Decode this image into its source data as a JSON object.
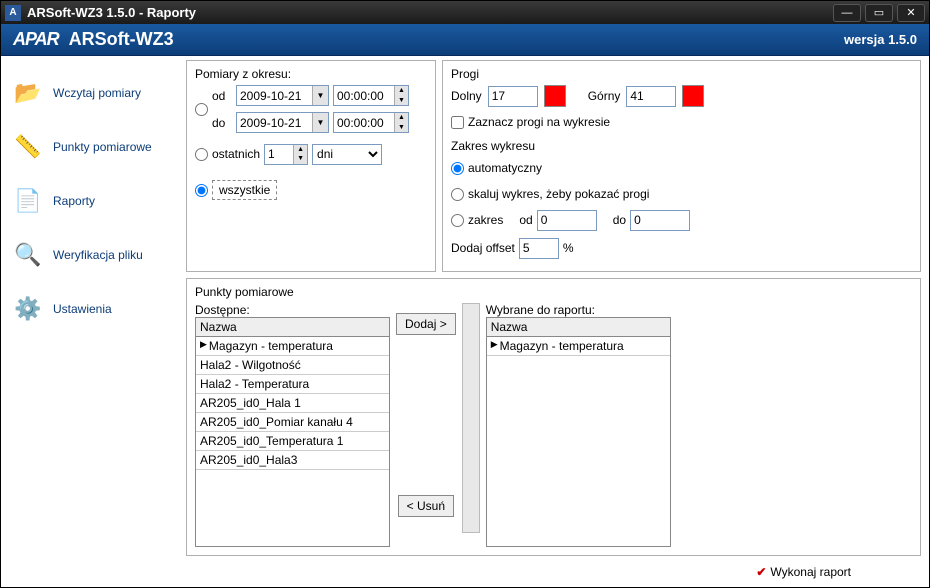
{
  "window": {
    "title": "ARSoft-WZ3 1.5.0 - Raporty"
  },
  "header": {
    "logo": "APAR",
    "app": "ARSoft-WZ3",
    "version": "wersja 1.5.0"
  },
  "sidebar": {
    "items": [
      {
        "label": "Wczytaj pomiary",
        "icon": "📂"
      },
      {
        "label": "Punkty pomiarowe",
        "icon": "📏"
      },
      {
        "label": "Raporty",
        "icon": "📄"
      },
      {
        "label": "Weryfikacja pliku",
        "icon": "🔍"
      },
      {
        "label": "Ustawienia",
        "icon": "⚙️"
      }
    ]
  },
  "period": {
    "legend": "Pomiary z okresu:",
    "from_label": "od",
    "from_date": "2009-10-21",
    "from_time": "00:00:00",
    "to_label": "do",
    "to_date": "2009-10-21",
    "to_time": "00:00:00",
    "last_label": "ostatnich",
    "last_value": "1",
    "last_unit": "dni",
    "all_label": "wszystkie"
  },
  "thresholds": {
    "legend": "Progi",
    "lower_label": "Dolny",
    "lower_value": "17",
    "upper_label": "Górny",
    "upper_value": "41",
    "mark_label": "Zaznacz progi na wykresie",
    "range_legend": "Zakres wykresu",
    "auto_label": "automatyczny",
    "scale_label": "skaluj wykres, żeby pokazać progi",
    "range_label": "zakres",
    "range_from_lbl": "od",
    "range_from": "0",
    "range_to_lbl": "do",
    "range_to": "0",
    "offset_label": "Dodaj offset",
    "offset_value": "5",
    "offset_unit": "%"
  },
  "points": {
    "legend": "Punkty pomiarowe",
    "available_label": "Dostępne:",
    "selected_label": "Wybrane do raportu:",
    "header": "Nazwa",
    "available": [
      "Magazyn - temperatura",
      "Hala2 - Wilgotność",
      "Hala2 - Temperatura",
      "AR205_id0_Hala 1",
      "AR205_id0_Pomiar kanału 4",
      "AR205_id0_Temperatura 1",
      "AR205_id0_Hala3"
    ],
    "selected": [
      "Magazyn - temperatura"
    ],
    "add_btn": "Dodaj >",
    "remove_btn": "< Usuń"
  },
  "footer": {
    "run": "Wykonaj raport"
  }
}
